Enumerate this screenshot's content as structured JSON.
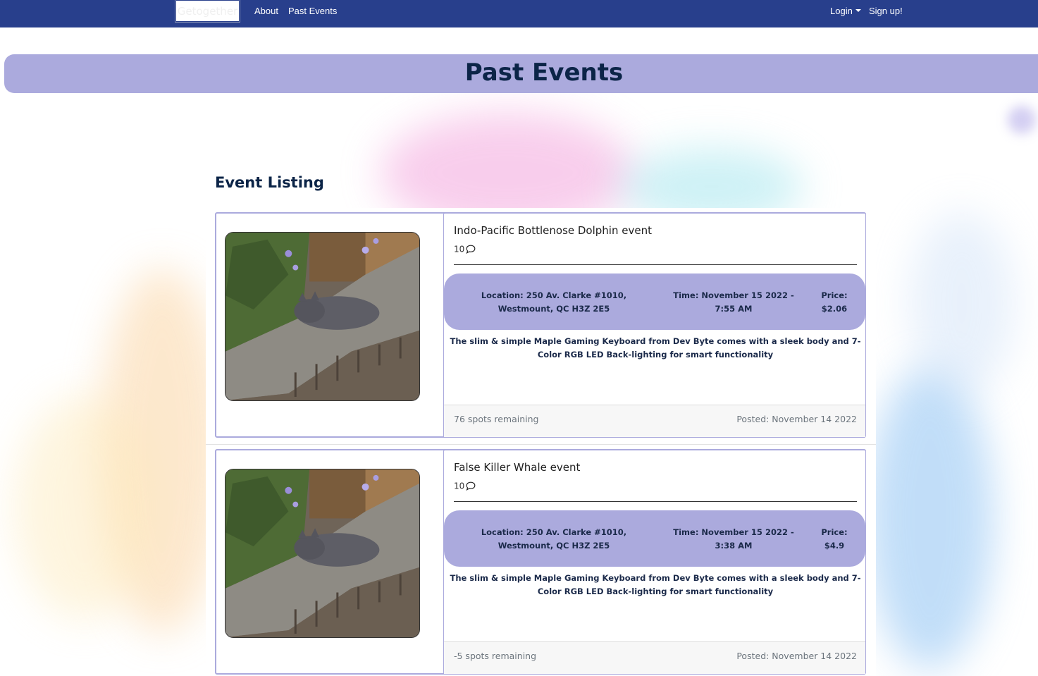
{
  "nav": {
    "brand": "Getogether",
    "about": "About",
    "past_events": "Past Events",
    "login": "Login",
    "signup": "Sign up!"
  },
  "banner": {
    "title": "Past Events"
  },
  "listing": {
    "heading": "Event Listing"
  },
  "events": [
    {
      "title": "Indo-Pacific Bottlenose Dolphin event",
      "comments": "10",
      "location": "Location: 250 Av. Clarke #1010, Westmount, QC H3Z 2E5",
      "time": "Time: November 15 2022 - 7:55 AM",
      "price": "Price: $2.06",
      "description": "The slim & simple Maple Gaming Keyboard from Dev Byte comes with a sleek body and 7- Color RGB LED Back-lighting for smart functionality",
      "spots": "76 spots remaining",
      "posted": "Posted: November 14 2022"
    },
    {
      "title": "False Killer Whale event",
      "comments": "10",
      "location": "Location: 250 Av. Clarke #1010, Westmount, QC H3Z 2E5",
      "time": "Time: November 15 2022 - 3:38 AM",
      "price": "Price: $4.9",
      "description": "The slim & simple Maple Gaming Keyboard from Dev Byte comes with a sleek body and 7- Color RGB LED Back-lighting for smart functionality",
      "spots": "-5 spots remaining",
      "posted": "Posted: November 14 2022"
    }
  ],
  "colors": {
    "navbar": "#283f8c",
    "banner": "#abaadd",
    "heading_text": "#0b2447"
  },
  "icons": {
    "comment": "speech-bubble-icon",
    "caret": "caret-down-icon"
  }
}
